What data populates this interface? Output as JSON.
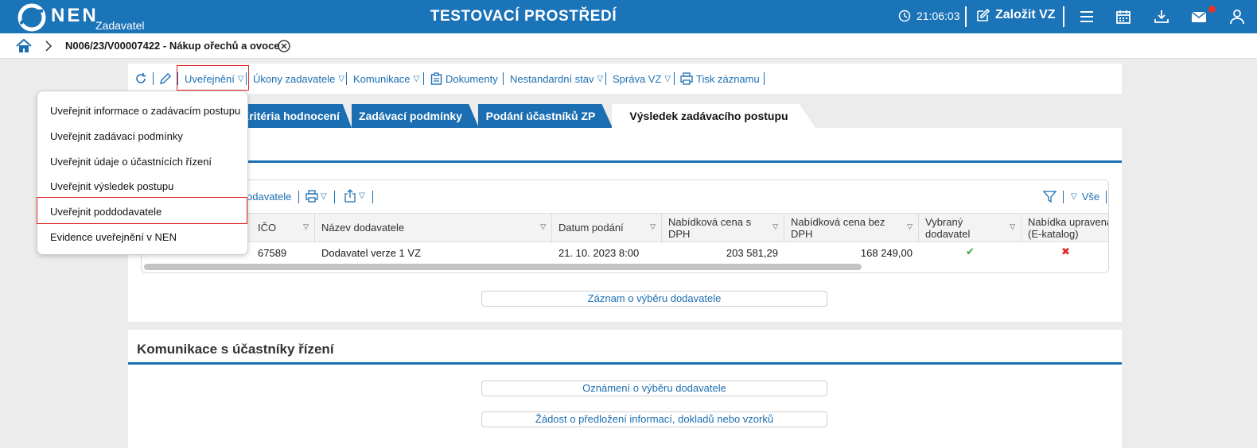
{
  "header": {
    "logo_text": "NEN",
    "logo_sub": "Zadavatel",
    "environment_title": "TESTOVACÍ PROSTŘEDÍ",
    "clock": "21:06:03",
    "create_label": "Založit VZ",
    "bg_color": "#1b73b8"
  },
  "breadcrumb": {
    "title": "N006/23/V00007422 - Nákup ořechů a ovoce"
  },
  "toolbar": {
    "items": [
      {
        "label": "Uveřejnění"
      },
      {
        "label": "Úkony zadavatele"
      },
      {
        "label": "Komunikace"
      },
      {
        "label": "Dokumenty"
      },
      {
        "label": "Nestandardní stav"
      },
      {
        "label": "Správa VZ"
      },
      {
        "label": "Tisk záznamu"
      }
    ]
  },
  "publish_menu": {
    "items": [
      {
        "label": "Uveřejnit informace o zadávacím postupu"
      },
      {
        "label": "Uveřejnit zadávací podmínky"
      },
      {
        "label": "Uveřejnit údaje o účastnících řízení"
      },
      {
        "label": "Uveřejnit výsledek postupu"
      },
      {
        "label": "Uveřejnit poddodavatele"
      },
      {
        "label": "Evidence uveřejnění v NEN"
      }
    ],
    "highlighted": "Uveřejnit poddodavatele"
  },
  "tabs": [
    {
      "label": "Kritéria hodnocení"
    },
    {
      "label": "Zadávací podmínky"
    },
    {
      "label": "Podání účastníků ZP"
    },
    {
      "label": "Výsledek zadávacího postupu"
    }
  ],
  "active_tab": "Výsledek zadávacího postupu",
  "grid": {
    "toolbar_partial_label": "odavatele",
    "filter_all_label": "Vše",
    "columns": [
      {
        "label": "IČO"
      },
      {
        "label": "Název dodavatele"
      },
      {
        "label": "Datum podání"
      },
      {
        "label": "Nabídková cena s DPH"
      },
      {
        "label": "Nabídková cena bez DPH"
      },
      {
        "label": "Vybraný dodavatel"
      },
      {
        "label": "Nabídka upravena (E-katalog)"
      }
    ],
    "rows": [
      {
        "ico": "67589",
        "name": "Dodavatel verze 1 VZ",
        "date": "21. 10. 2023 8:00",
        "price_vat": "203 581,29",
        "price_novat": "168 249,00",
        "selected": "✔",
        "modified": "✖"
      }
    ]
  },
  "section1": {
    "button_label": "Záznam o výběru dodavatele"
  },
  "section2": {
    "title": "Komunikace s účastníky řízení",
    "buttons": [
      {
        "label": "Oznámení o výběru dodavatele"
      },
      {
        "label": "Žádost o předložení informací, dokladů nebo vzorků"
      }
    ]
  }
}
